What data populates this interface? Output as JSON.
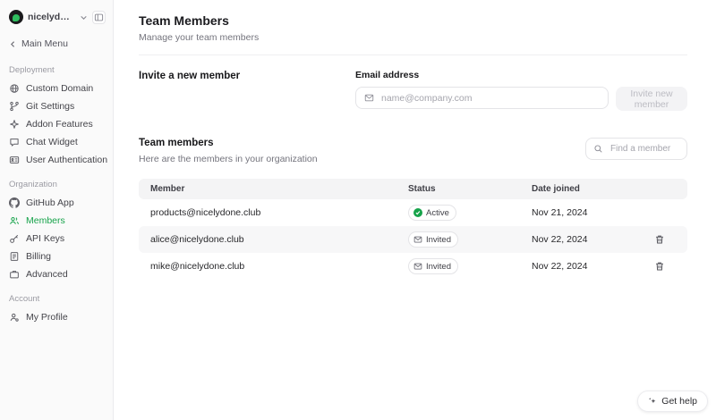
{
  "colors": {
    "accent_green": "#16a34a",
    "sidebar_bg": "#fafafa",
    "table_header_bg": "#f4f4f5"
  },
  "topbar": {
    "workspace": "nicelydone--...",
    "back": "Main Menu"
  },
  "sidebar": {
    "sections": [
      {
        "label": "Deployment",
        "items": [
          {
            "label": "Custom Domain",
            "icon": "globe-icon"
          },
          {
            "label": "Git Settings",
            "icon": "git-branch-icon"
          },
          {
            "label": "Addon Features",
            "icon": "sparkle-icon"
          },
          {
            "label": "Chat Widget",
            "icon": "chat-bubble-icon"
          },
          {
            "label": "User Authentication",
            "icon": "id-card-icon"
          }
        ]
      },
      {
        "label": "Organization",
        "items": [
          {
            "label": "GitHub App",
            "icon": "github-icon"
          },
          {
            "label": "Members",
            "icon": "users-icon",
            "active": true
          },
          {
            "label": "API Keys",
            "icon": "key-icon"
          },
          {
            "label": "Billing",
            "icon": "receipt-icon"
          },
          {
            "label": "Advanced",
            "icon": "briefcase-icon"
          }
        ]
      },
      {
        "label": "Account",
        "items": [
          {
            "label": "My Profile",
            "icon": "user-icon"
          }
        ]
      }
    ]
  },
  "page": {
    "title": "Team Members",
    "subtitle": "Manage your team members"
  },
  "invite": {
    "heading": "Invite a new member",
    "email_label": "Email address",
    "email_placeholder": "name@company.com",
    "submit_label": "Invite new member"
  },
  "team": {
    "heading": "Team members",
    "subtitle": "Here are the members in your organization",
    "search_placeholder": "Find a member",
    "columns": [
      "Member",
      "Status",
      "Date joined"
    ],
    "rows": [
      {
        "member": "products@nicelydone.club",
        "status": "Active",
        "date": "Nov 21, 2024"
      },
      {
        "member": "alice@nicelydone.club",
        "status": "Invited",
        "date": "Nov 22, 2024"
      },
      {
        "member": "mike@nicelydone.club",
        "status": "Invited",
        "date": "Nov 22, 2024"
      }
    ]
  },
  "help": {
    "label": "Get help"
  }
}
